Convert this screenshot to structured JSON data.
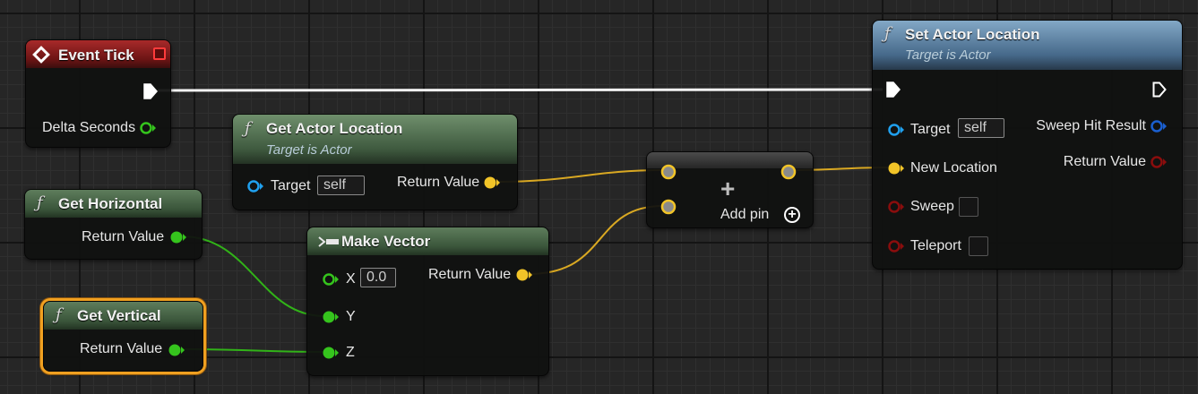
{
  "nodes": {
    "event_tick": {
      "title": "Event Tick",
      "delta_seconds": "Delta Seconds"
    },
    "get_actor_location": {
      "title": "Get Actor Location",
      "subtitle": "Target is Actor",
      "target_label": "Target",
      "target_value": "self",
      "return_label": "Return Value"
    },
    "get_horizontal": {
      "title": "Get Horizontal",
      "return_label": "Return Value"
    },
    "get_vertical": {
      "title": "Get Vertical",
      "return_label": "Return Value",
      "selected": true
    },
    "make_vector": {
      "title": "Make Vector",
      "x_label": "X",
      "x_value": "0.0",
      "y_label": "Y",
      "z_label": "Z",
      "return_label": "Return Value"
    },
    "add": {
      "add_pin_label": "Add pin"
    },
    "set_actor_location": {
      "title": "Set Actor Location",
      "subtitle": "Target is Actor",
      "target_label": "Target",
      "target_value": "self",
      "new_location_label": "New Location",
      "sweep_label": "Sweep",
      "teleport_label": "Teleport",
      "sweep_hit_label": "Sweep Hit Result",
      "return_label": "Return Value",
      "sweep_checked": false,
      "teleport_checked": false
    }
  },
  "colors": {
    "exec": "#ffffff",
    "float": "#35c41d",
    "vector": "#f2c428",
    "object": "#20a0ee",
    "struct": "#1a5fd0",
    "bool": "#8a0d0d"
  },
  "icons": [
    "event-diamond-icon",
    "function-icon",
    "make-struct-icon",
    "add-pin-icon",
    "plus-icon"
  ]
}
